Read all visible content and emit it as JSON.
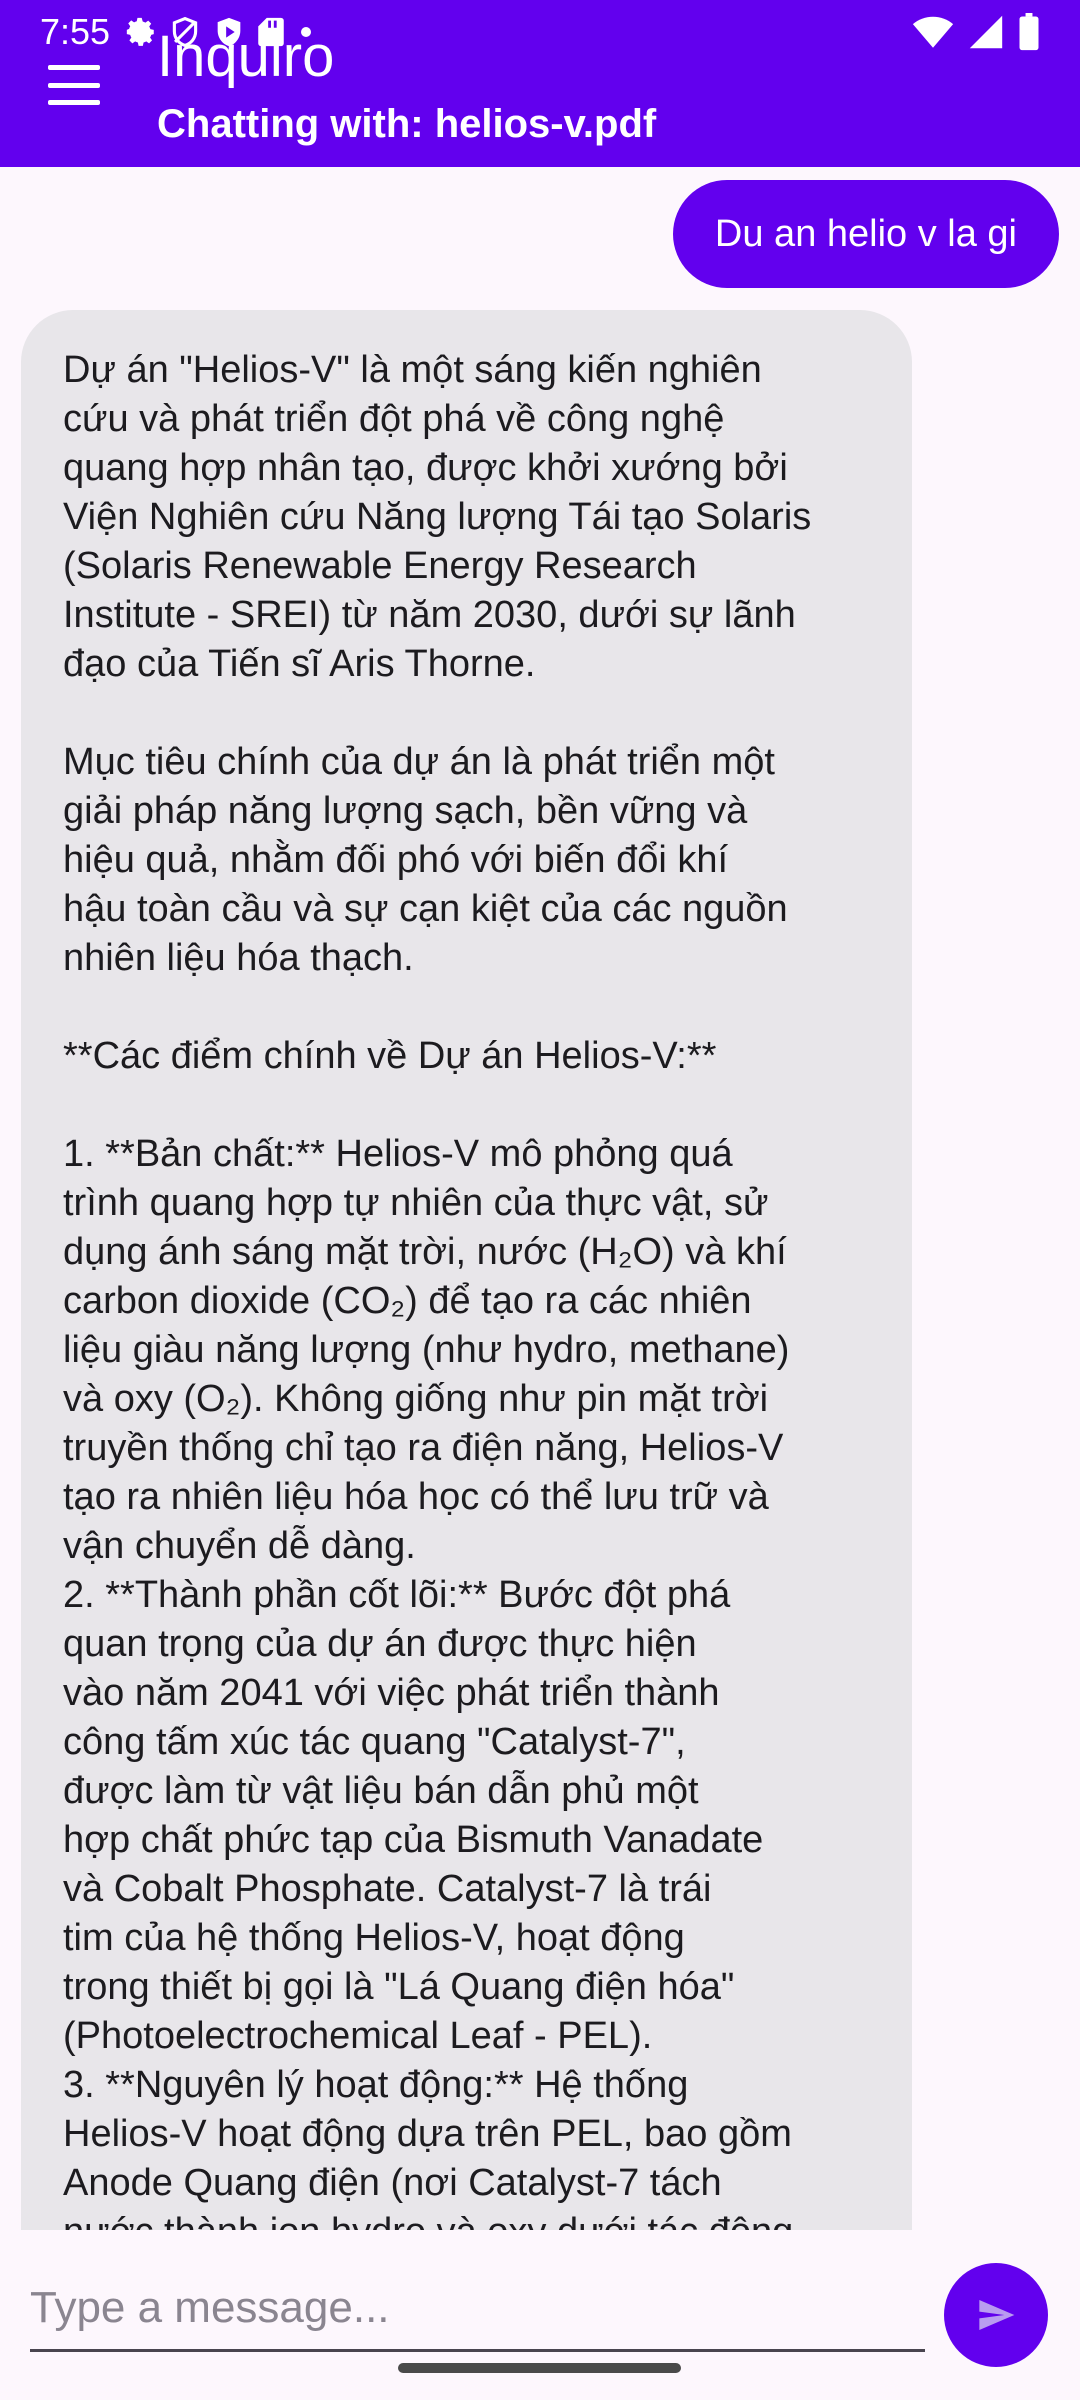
{
  "status_bar": {
    "time": "7:55",
    "left_icons": [
      "gear-icon",
      "shield-icon",
      "play-protect-icon",
      "sd-card-icon",
      "dot-icon"
    ],
    "right_icons": [
      "wifi-icon",
      "signal-icon",
      "battery-icon"
    ]
  },
  "app_bar": {
    "title": "Inquiro",
    "subtitle": "Chatting with: helios-v.pdf",
    "menu_icon": "hamburger-menu-icon"
  },
  "colors": {
    "primary": "#6200ee",
    "bot_bubble": "#e8e6ea",
    "background": "#fdf7fd"
  },
  "messages": {
    "user": "Du an helio v la gi",
    "bot_lines": [
      "Dự án \"Helios-V\" là một sáng kiến nghiên",
      "cứu và phát triển đột phá về công nghệ",
      "quang hợp nhân tạo, được khởi xướng bởi",
      "Viện Nghiên cứu Năng lượng Tái tạo Solaris",
      "(Solaris Renewable Energy Research",
      "Institute - SREI) từ năm 2030, dưới sự lãnh",
      "đạo của Tiến sĩ Aris Thorne.",
      "",
      "Mục tiêu chính của dự án là phát triển một",
      "giải pháp năng lượng sạch, bền vững và",
      "hiệu quả, nhằm đối phó với biến đổi khí",
      "hậu toàn cầu và sự cạn kiệt của các nguồn",
      "nhiên liệu hóa thạch.",
      "",
      "**Các điểm chính về Dự án Helios-V:**",
      "",
      "1.  **Bản chất:** Helios-V mô phỏng quá",
      "trình quang hợp tự nhiên của thực vật, sử",
      "dụng ánh sáng mặt trời, nước (H₂O) và khí",
      "carbon dioxide (CO₂) để tạo ra các nhiên",
      "liệu giàu năng lượng (như hydro, methane)",
      "và oxy (O₂). Không giống như pin mặt trời",
      "truyền thống chỉ tạo ra điện năng, Helios-V",
      "tạo ra nhiên liệu hóa học có thể lưu trữ và",
      "vận chuyển dễ dàng.",
      "2.  **Thành phần cốt lõi:** Bước đột phá",
      "quan trọng của dự án được thực hiện",
      "vào năm 2041 với việc phát triển thành",
      "công tấm xúc tác quang \"Catalyst-7\",",
      "được làm từ vật liệu bán dẫn phủ một",
      "hợp chất phức tạp của Bismuth Vanadate",
      "và Cobalt Phosphate. Catalyst-7 là trái",
      "tim của hệ thống Helios-V, hoạt động",
      "trong thiết bị gọi là \"Lá Quang điện hóa\"",
      "(Photoelectrochemical Leaf - PEL).",
      "3.  **Nguyên lý hoạt động:** Hệ thống",
      "Helios-V hoạt động dựa trên PEL, bao gồm",
      "Anode Quang điện (nơi Catalyst-7 tách",
      "nước thành ion hydro và oxy dưới tác động"
    ]
  },
  "composer": {
    "placeholder": "Type a message...",
    "send_icon": "send-icon"
  }
}
